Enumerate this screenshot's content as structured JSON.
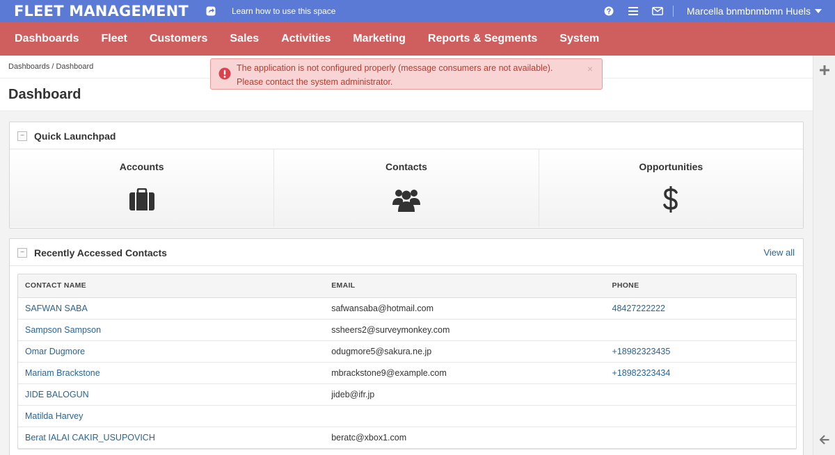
{
  "topbar": {
    "brand": "FLEET MANAGEMENT",
    "learn_link": "Learn how to use this space",
    "user_name": "Marcella bnmbnmbmn Huels",
    "icons": [
      "share-icon",
      "help-icon",
      "menu-icon",
      "mail-icon"
    ]
  },
  "nav": {
    "items": [
      {
        "label": "Dashboards"
      },
      {
        "label": "Fleet"
      },
      {
        "label": "Customers"
      },
      {
        "label": "Sales"
      },
      {
        "label": "Activities"
      },
      {
        "label": "Marketing"
      },
      {
        "label": "Reports & Segments"
      },
      {
        "label": "System"
      }
    ]
  },
  "breadcrumb": "Dashboards / Dashboard",
  "page_title": "Dashboard",
  "alert": {
    "line1": "The application is not configured properly (message consumers are not available).",
    "line2": "Please contact the system administrator.",
    "close": "×"
  },
  "quick_launchpad": {
    "title": "Quick Launchpad",
    "tiles": [
      {
        "label": "Accounts",
        "icon": "briefcase-icon"
      },
      {
        "label": "Contacts",
        "icon": "users-icon"
      },
      {
        "label": "Opportunities",
        "icon": "dollar-icon"
      }
    ]
  },
  "recent_contacts": {
    "title": "Recently Accessed Contacts",
    "view_all": "View all",
    "columns": [
      "CONTACT NAME",
      "EMAIL",
      "PHONE"
    ],
    "rows": [
      {
        "name": "SAFWAN SABA",
        "email": "safwansaba@hotmail.com",
        "phone": "48427222222"
      },
      {
        "name": "Sampson Sampson",
        "email": "ssheers2@surveymonkey.com",
        "phone": ""
      },
      {
        "name": "Omar Dugmore",
        "email": "odugmore5@sakura.ne.jp",
        "phone": "+18982323435"
      },
      {
        "name": "Mariam Brackstone",
        "email": "mbrackstone9@example.com",
        "phone": "+18982323434"
      },
      {
        "name": "JIDE BALOGUN",
        "email": "jideb@ifr.jp",
        "phone": ""
      },
      {
        "name": "Matilda Harvey",
        "email": "",
        "phone": ""
      },
      {
        "name": "Berat IALAI CAKIR_USUPOVICH",
        "email": "beratc@xbox1.com",
        "phone": ""
      }
    ]
  },
  "colors": {
    "topbar": "#5b7ad6",
    "nav": "#cf5f5f",
    "link": "#2a6496",
    "alert_bg": "#f8d4d4",
    "alert_text": "#c0392b"
  }
}
